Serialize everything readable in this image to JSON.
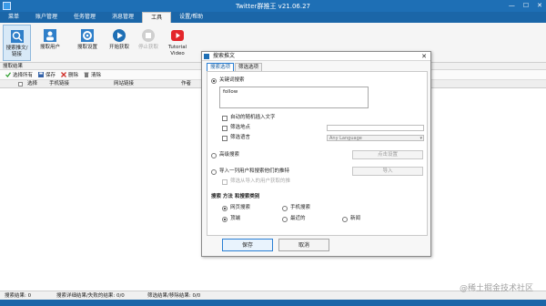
{
  "window": {
    "title": "Twitter群推王 v21.06.27",
    "controls": [
      "—",
      "☐",
      "✕"
    ]
  },
  "menu": [
    "菜单",
    "账户管理",
    "任务管理",
    "消息管理",
    "工具",
    "设置/帮助"
  ],
  "ribbon": {
    "buttons": [
      {
        "label": "搜索推文/链接",
        "icon": "search-tweets-icon",
        "state": "selected"
      },
      {
        "label": "搜取用户",
        "icon": "search-users-icon",
        "state": "normal"
      },
      {
        "label": "搜取设置",
        "icon": "settings-icon",
        "state": "normal"
      },
      {
        "label": "开始获取",
        "icon": "play-icon",
        "state": "normal"
      },
      {
        "label": "停止获取",
        "icon": "stop-icon",
        "state": "disabled"
      },
      {
        "label": "Tutorial Video",
        "icon": "youtube-icon",
        "state": "normal"
      }
    ]
  },
  "section_label": "搜取结果",
  "toolbar": {
    "select_all": "选择所有",
    "save": "保存",
    "delete": "删除",
    "clear": "清除"
  },
  "grid": {
    "columns": [
      "选择",
      "手机链接",
      "网站链接",
      "作者"
    ]
  },
  "status": {
    "search_result": "搜索结果: 0",
    "detail": "搜索详细结果/失败的结果: 0/0",
    "filter": "筛选结果/移除结果: 0/0"
  },
  "watermark": "@稀土掘金技术社区",
  "dialog": {
    "title": "搜索推文",
    "tabs": [
      "搜索选项",
      "筛选选项"
    ],
    "keyword_radio": "关键词搜索",
    "keyword_value": "follow",
    "opt_random": "自动的随机插入文字",
    "opt_location": "筛选地点",
    "opt_language": "筛选语言",
    "language_placeholder": "Any Language",
    "advanced_radio": "高级搜索",
    "advanced_button": "点击设置",
    "import_radio": "导入一列用户和搜索他们的推特",
    "import_button": "导入",
    "import_sub": "筛选从导入的用户获取的推",
    "method_label": "搜索 方法 和搜索类别",
    "method_web": "网页搜索",
    "method_mobile": "手机搜索",
    "type_top": "顶端",
    "type_latest": "最近的",
    "type_news": "新闻",
    "ok": "保存",
    "cancel": "取消"
  },
  "colors": {
    "title_blue": "#1e6fb5",
    "menu_blue": "#1b66a8",
    "accent": "#2a7fd4"
  }
}
